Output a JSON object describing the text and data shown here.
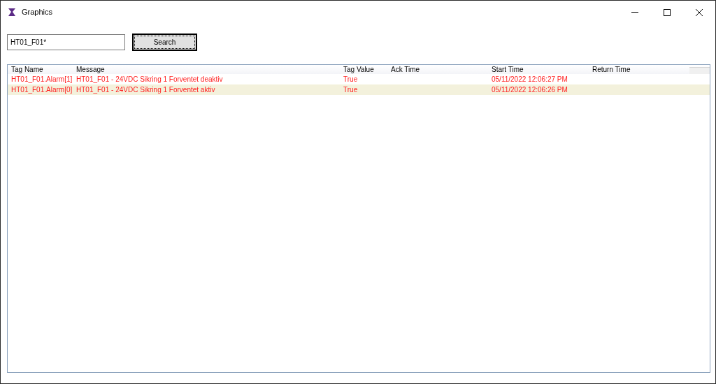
{
  "window": {
    "title": "Graphics"
  },
  "search": {
    "value": "HT01_F01*",
    "button": "Search"
  },
  "table": {
    "columns": [
      "Tag Name",
      "Message",
      "Tag Value",
      "Ack Time",
      "Start Time",
      "Return Time"
    ],
    "rows": [
      {
        "cells": [
          "HT01_F01.Alarm[1]",
          "HT01_F01 - 24VDC Sikring 1 Forventet deaktiv",
          "True",
          "",
          "05/11/2022 12:06:27 PM",
          ""
        ],
        "selected": false
      },
      {
        "cells": [
          "HT01_F01.Alarm[0]",
          "HT01_F01 - 24VDC Sikring 1 Forventet aktiv",
          "True",
          "",
          "05/11/2022 12:06:26 PM",
          ""
        ],
        "selected": true
      }
    ]
  }
}
